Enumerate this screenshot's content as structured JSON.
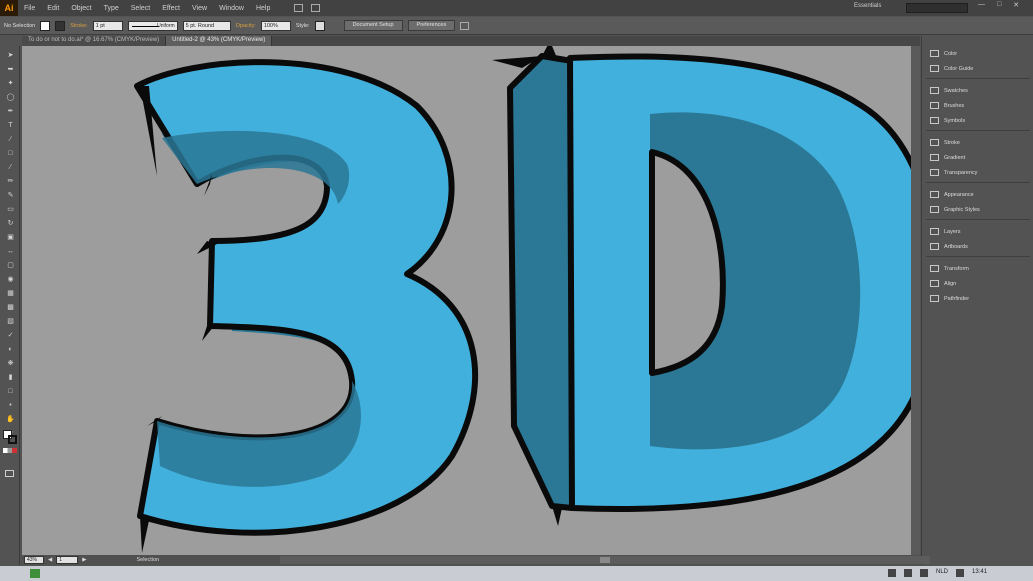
{
  "app": {
    "logo": "Ai",
    "workspace": "Essentials"
  },
  "menu": [
    "File",
    "Edit",
    "Object",
    "Type",
    "Select",
    "Effect",
    "View",
    "Window",
    "Help"
  ],
  "control_bar": {
    "selection_label": "No Selection",
    "stroke_label": "Stroke:",
    "stroke_weight": "1 pt",
    "stroke_profile": "Uniform",
    "brush": "5 pt. Round",
    "opacity_label": "Opacity:",
    "opacity_value": "100%",
    "style_label": "Style:",
    "doc_setup_button": "Document Setup",
    "preferences_button": "Preferences"
  },
  "tabs": [
    {
      "label": "To do or not to do.ai* @ 16.67% (CMYK/Preview)",
      "active": false
    },
    {
      "label": "Untitled-2 @ 43% (CMYK/Preview)",
      "active": true
    }
  ],
  "panels": [
    {
      "label": "Color",
      "icon": "color-icon"
    },
    {
      "label": "Color Guide",
      "icon": "color-guide-icon"
    },
    {
      "label": "Swatches",
      "icon": "swatches-icon"
    },
    {
      "label": "Brushes",
      "icon": "brushes-icon"
    },
    {
      "label": "Symbols",
      "icon": "symbols-icon"
    },
    {
      "label": "Stroke",
      "icon": "stroke-icon"
    },
    {
      "label": "Gradient",
      "icon": "gradient-icon"
    },
    {
      "label": "Transparency",
      "icon": "transparency-icon"
    },
    {
      "label": "Appearance",
      "icon": "appearance-icon"
    },
    {
      "label": "Graphic Styles",
      "icon": "graphic-styles-icon"
    },
    {
      "label": "Layers",
      "icon": "layers-icon"
    },
    {
      "label": "Artboards",
      "icon": "artboards-icon"
    },
    {
      "label": "Transform",
      "icon": "transform-icon"
    },
    {
      "label": "Align",
      "icon": "align-icon"
    },
    {
      "label": "Pathfinder",
      "icon": "pathfinder-icon"
    }
  ],
  "status_bar": {
    "zoom": "43%",
    "artboard": "1",
    "tool": "Selection"
  },
  "taskbar": {
    "language": "NLD",
    "time": "13:41"
  },
  "colors": {
    "letter_light": "#42b0dc",
    "letter_dark": "#2a7896",
    "outline": "#0a0a0a",
    "canvas": "#9d9d9d"
  }
}
